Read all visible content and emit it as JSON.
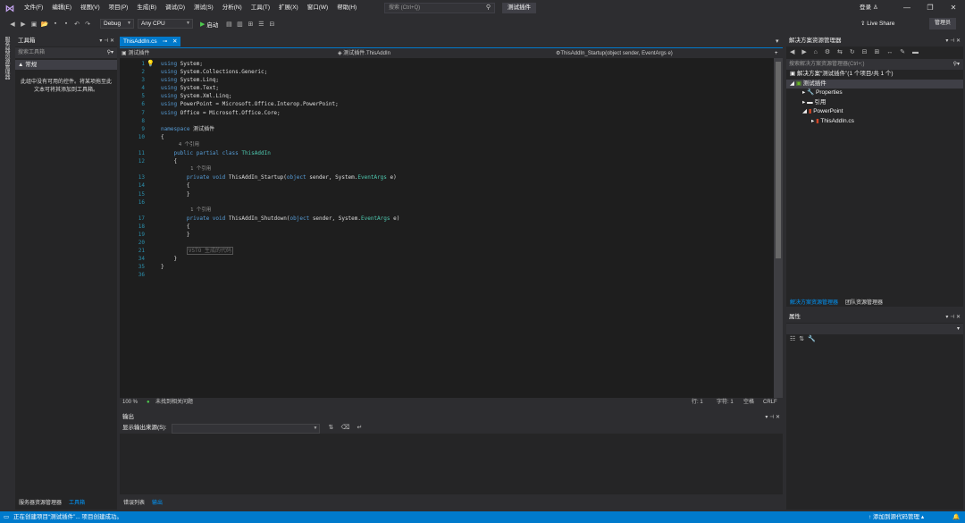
{
  "menubar": {
    "items": [
      "文件(F)",
      "编辑(E)",
      "视图(V)",
      "项目(P)",
      "生成(B)",
      "调试(D)",
      "测试(S)",
      "分析(N)",
      "工具(T)",
      "扩展(X)",
      "窗口(W)",
      "帮助(H)"
    ],
    "search_placeholder": "搜索 (Ctrl+Q)",
    "solution_name": "测试插件",
    "login": "登录"
  },
  "toolbar": {
    "config": "Debug",
    "platform": "Any CPU",
    "start": "启动",
    "liveshare": "Live Share",
    "manager": "管理员"
  },
  "leftstrip": {
    "label": "服务器资源管理器"
  },
  "toolbox": {
    "title": "工具箱",
    "search_placeholder": "搜索工具箱",
    "group": "▲ 常规",
    "empty_text": "此组中没有可用的控件。将某项拖至此文本可将其添加到工具箱。",
    "tabs": [
      "服务器资源管理器",
      "工具箱"
    ]
  },
  "editor": {
    "tab": "ThisAddIn.cs",
    "nav_project": "测试插件",
    "nav_class": "测试插件.ThisAddIn",
    "nav_member": "ThisAddIn_Startup(object sender, EventArgs e)",
    "line_numbers": [
      "1",
      "2",
      "3",
      "4",
      "5",
      "6",
      "7",
      "8",
      "9",
      "10",
      "",
      "11",
      "12",
      "",
      "13",
      "14",
      "15",
      "16",
      "",
      "17",
      "18",
      "19",
      "20",
      "21",
      "34",
      "35",
      "36"
    ],
    "status": {
      "zoom": "100 %",
      "issues": "未找到相关问题",
      "line": "行: 1",
      "char": "字符: 1",
      "insert": "空格",
      "eol": "CRLF"
    }
  },
  "output": {
    "title": "输出",
    "source_label": "显示输出来源(S):",
    "tabs": [
      "错误列表",
      "输出"
    ]
  },
  "solution_explorer": {
    "title": "解决方案资源管理器",
    "search_placeholder": "搜索解决方案资源管理器(Ctrl+;)",
    "solution": "解决方案“测试插件”(1 个项目/共 1 个)",
    "project": "测试插件",
    "properties": "Properties",
    "references": "引用",
    "powerpoint": "PowerPoint",
    "file": "ThisAddIn.cs",
    "tabs": [
      "解决方案资源管理器",
      "团队资源管理器"
    ]
  },
  "properties": {
    "title": "属性"
  },
  "statusbar": {
    "message": "正在创建项目“测试插件”... 项目创建成功。",
    "source_control": "↑ 添加到源代码管理 ▴"
  }
}
